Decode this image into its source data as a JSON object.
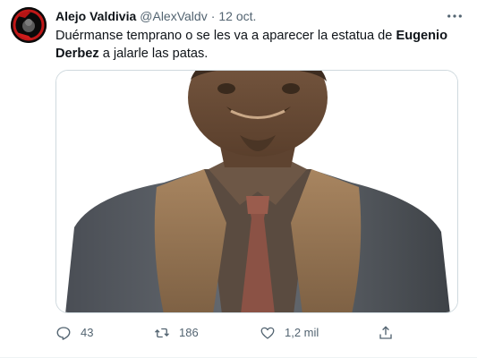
{
  "tweet": {
    "author": {
      "display_name": "Alejo Valdivia",
      "handle": "@AlexValdv",
      "separator": "·",
      "time": "12 oct."
    },
    "text": {
      "part1": "Duérmanse temprano o se les va a aparecer la estatua de ",
      "bold": "Eugenio Derbez",
      "part2": " a jalarle las patas."
    },
    "media": {
      "icon": "bronze-statue-photo"
    },
    "more_icon": "more-dots-icon",
    "actions": {
      "reply": {
        "icon": "reply-icon",
        "count": "43"
      },
      "retweet": {
        "icon": "retweet-icon",
        "count": "186"
      },
      "like": {
        "icon": "heart-icon",
        "count": "1,2 mil"
      },
      "share": {
        "icon": "share-icon"
      }
    }
  },
  "colors": {
    "text_primary": "#0f1419",
    "text_secondary": "#536471",
    "border": "#cfd9de"
  }
}
